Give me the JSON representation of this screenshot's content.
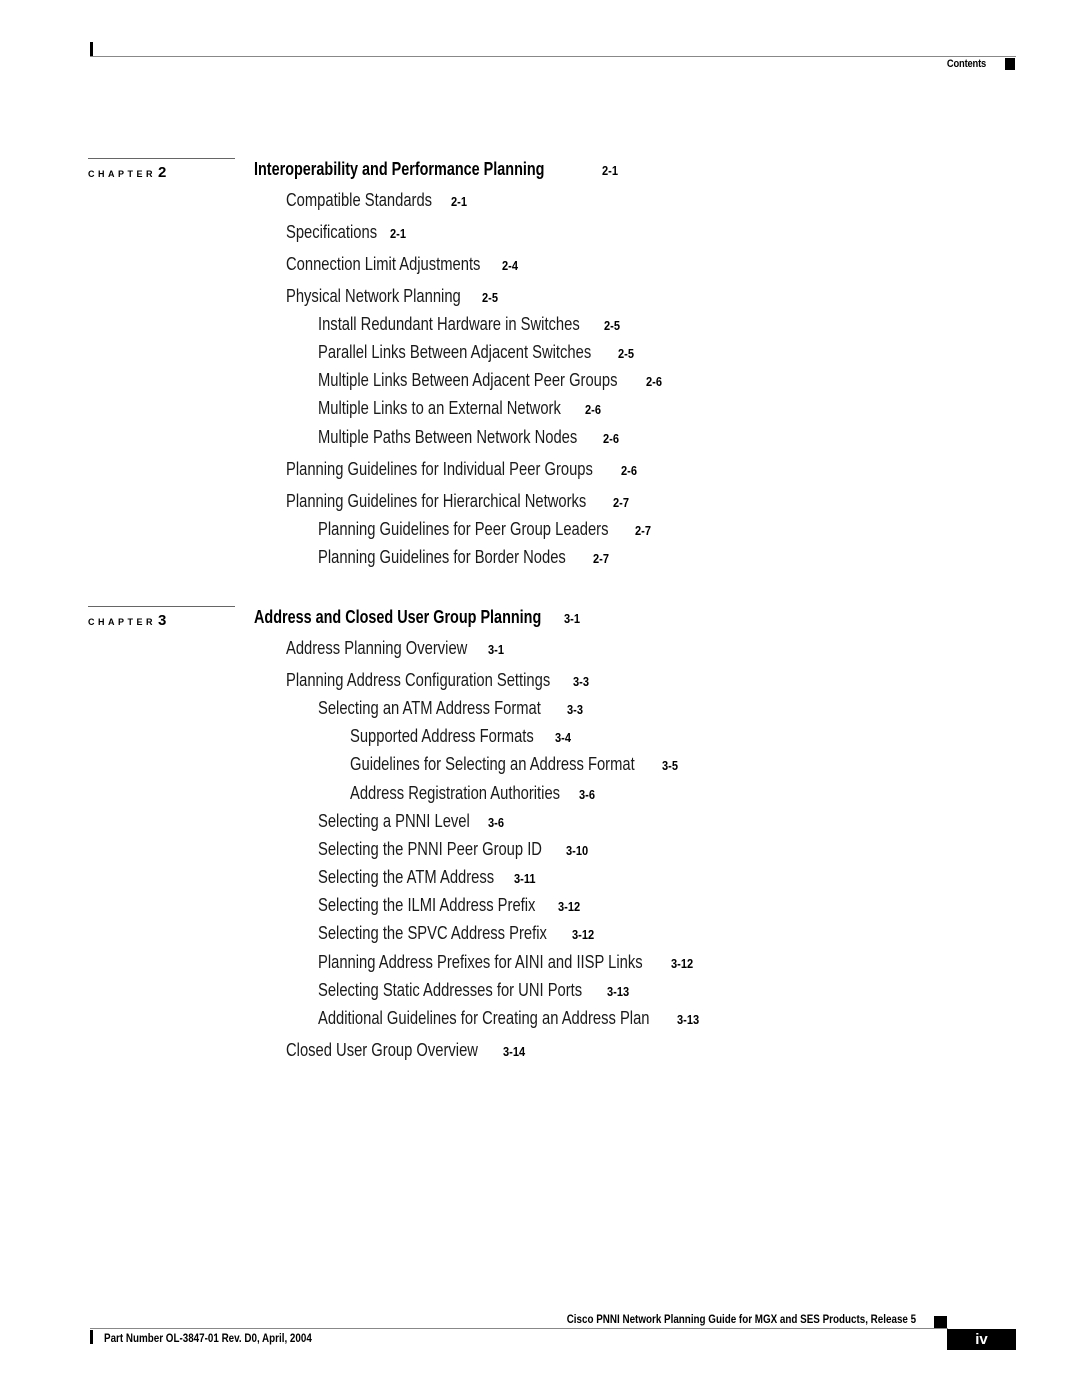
{
  "header": {
    "section_label": "Contents"
  },
  "chapters": [
    {
      "label": "CHAPTER",
      "number": "2",
      "title": "Interoperability and Performance Planning",
      "page": "2-1",
      "entries": [
        {
          "title": "Compatible Standards",
          "page": "2-1",
          "level": 1
        },
        {
          "title": "Specifications",
          "page": "2-1",
          "level": 1
        },
        {
          "title": "Connection Limit Adjustments",
          "page": "2-4",
          "level": 1
        },
        {
          "title": "Physical Network Planning",
          "page": "2-5",
          "level": 1
        },
        {
          "title": "Install Redundant Hardware in Switches",
          "page": "2-5",
          "level": 2
        },
        {
          "title": "Parallel Links Between Adjacent Switches",
          "page": "2-5",
          "level": 2
        },
        {
          "title": "Multiple Links Between Adjacent Peer Groups",
          "page": "2-6",
          "level": 2
        },
        {
          "title": "Multiple Links to an External Network",
          "page": "2-6",
          "level": 2
        },
        {
          "title": "Multiple Paths Between Network Nodes",
          "page": "2-6",
          "level": 2
        },
        {
          "title": "Planning Guidelines for Individual Peer Groups",
          "page": "2-6",
          "level": 1
        },
        {
          "title": "Planning Guidelines for Hierarchical Networks",
          "page": "2-7",
          "level": 1
        },
        {
          "title": "Planning Guidelines for Peer Group Leaders",
          "page": "2-7",
          "level": 2
        },
        {
          "title": "Planning Guidelines for Border Nodes",
          "page": "2-7",
          "level": 2
        }
      ]
    },
    {
      "label": "CHAPTER",
      "number": "3",
      "title": "Address and Closed User Group Planning",
      "page": "3-1",
      "entries": [
        {
          "title": "Address Planning Overview",
          "page": "3-1",
          "level": 1
        },
        {
          "title": "Planning Address Configuration Settings",
          "page": "3-3",
          "level": 1
        },
        {
          "title": "Selecting an ATM Address Format",
          "page": "3-3",
          "level": 2
        },
        {
          "title": "Supported Address Formats",
          "page": "3-4",
          "level": 3
        },
        {
          "title": "Guidelines for Selecting an Address Format",
          "page": "3-5",
          "level": 3
        },
        {
          "title": "Address Registration Authorities",
          "page": "3-6",
          "level": 3
        },
        {
          "title": "Selecting a PNNI Level",
          "page": "3-6",
          "level": 2
        },
        {
          "title": "Selecting the PNNI Peer Group ID",
          "page": "3-10",
          "level": 2
        },
        {
          "title": "Selecting the ATM Address",
          "page": "3-11",
          "level": 2
        },
        {
          "title": "Selecting the ILMI Address Prefix",
          "page": "3-12",
          "level": 2
        },
        {
          "title": "Selecting the SPVC Address Prefix",
          "page": "3-12",
          "level": 2
        },
        {
          "title": "Planning Address Prefixes for AINI and IISP Links",
          "page": "3-12",
          "level": 2
        },
        {
          "title": "Selecting Static Addresses for UNI Ports",
          "page": "3-13",
          "level": 2
        },
        {
          "title": "Additional Guidelines for Creating an Address Plan",
          "page": "3-13",
          "level": 2
        },
        {
          "title": "Closed User Group Overview",
          "page": "3-14",
          "level": 1
        }
      ]
    }
  ],
  "footer": {
    "book_title": "Cisco PNNI Network Planning Guide  for MGX and SES Products, Release 5",
    "part_number": "Part Number OL-3847-01 Rev. D0, April, 2004",
    "page_number": "iv"
  }
}
